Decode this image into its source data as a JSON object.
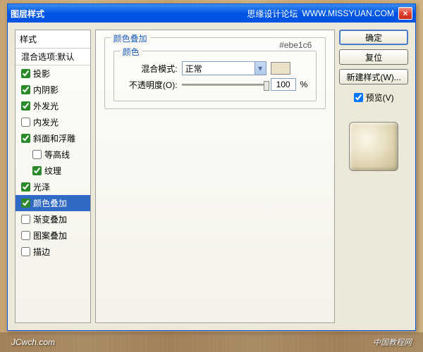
{
  "titlebar": {
    "title": "图层样式",
    "brand": "思缘设计论坛",
    "url": "WWW.MISSYUAN.COM"
  },
  "stylePanel": {
    "header": "样式",
    "defaultRow": "混合选项:默认",
    "items": [
      {
        "label": "投影",
        "checked": true,
        "indent": false
      },
      {
        "label": "内阴影",
        "checked": true,
        "indent": false
      },
      {
        "label": "外发光",
        "checked": true,
        "indent": false
      },
      {
        "label": "内发光",
        "checked": false,
        "indent": false
      },
      {
        "label": "斜面和浮雕",
        "checked": true,
        "indent": false
      },
      {
        "label": "等高线",
        "checked": false,
        "indent": true
      },
      {
        "label": "纹理",
        "checked": true,
        "indent": true
      },
      {
        "label": "光泽",
        "checked": true,
        "indent": false
      },
      {
        "label": "颜色叠加",
        "checked": true,
        "indent": false,
        "selected": true
      },
      {
        "label": "渐变叠加",
        "checked": false,
        "indent": false
      },
      {
        "label": "图案叠加",
        "checked": false,
        "indent": false
      },
      {
        "label": "描边",
        "checked": false,
        "indent": false
      }
    ]
  },
  "settings": {
    "groupTitle": "颜色叠加",
    "innerTitle": "颜色",
    "blendLabel": "混合模式:",
    "blendValue": "正常",
    "hexValue": "#ebe1c6",
    "opacityLabel": "不透明度(O):",
    "opacityValue": "100",
    "opacityUnit": "%"
  },
  "buttons": {
    "ok": "确定",
    "reset": "复位",
    "newStyle": "新建样式(W)...",
    "preview": "预览(V)"
  },
  "footer": {
    "left": "JCwch.com",
    "right": "中国教程网"
  }
}
